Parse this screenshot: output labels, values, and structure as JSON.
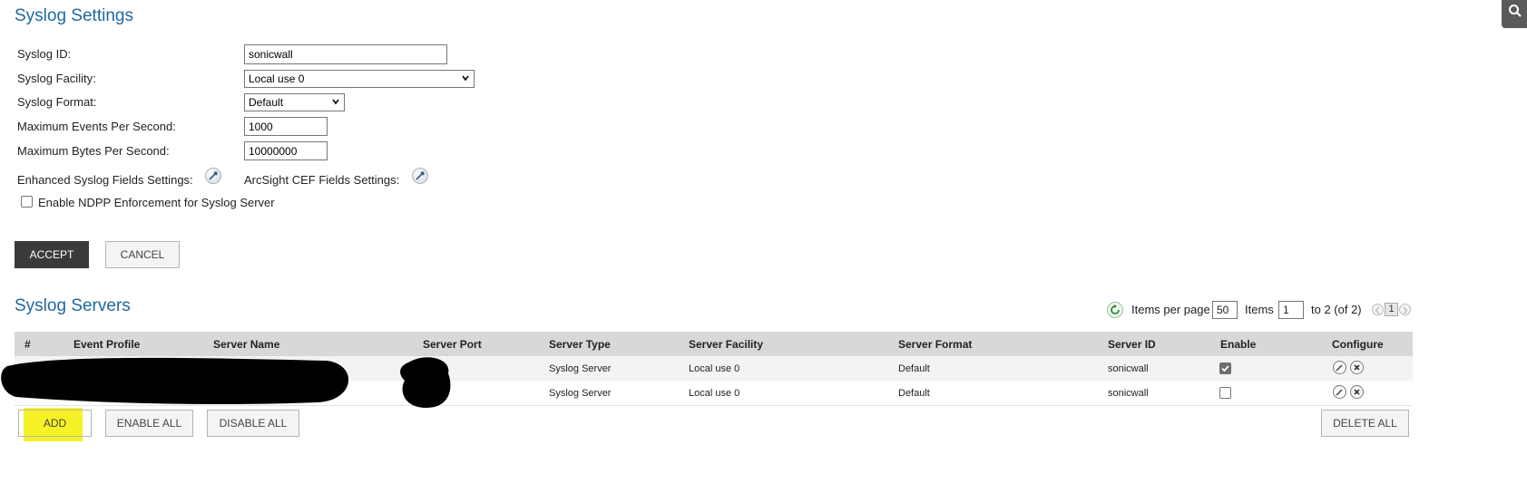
{
  "settings": {
    "title": "Syslog Settings",
    "syslog_id_label": "Syslog ID:",
    "syslog_id_value": "sonicwall",
    "facility_label": "Syslog Facility:",
    "facility_value": "Local use 0",
    "format_label": "Syslog Format:",
    "format_value": "Default",
    "max_events_label": "Maximum Events Per Second:",
    "max_events_value": "1000",
    "max_bytes_label": "Maximum Bytes Per Second:",
    "max_bytes_value": "10000000",
    "enhanced_label": "Enhanced Syslog Fields Settings:",
    "arcsight_label": "ArcSight CEF Fields Settings:",
    "ndpp_label": "Enable NDPP Enforcement for Syslog Server",
    "ndpp_checked": false,
    "accept_label": "ACCEPT",
    "cancel_label": "CANCEL"
  },
  "servers": {
    "title": "Syslog Servers",
    "items_per_page_label": "Items per page",
    "items_per_page_value": "50",
    "items_label": "Items",
    "items_start_value": "1",
    "items_range_text": "to 2 (of 2)",
    "current_page": "1",
    "columns": [
      "#",
      "Event Profile",
      "Server Name",
      "Server Port",
      "Server Type",
      "Server Facility",
      "Server Format",
      "Server ID",
      "Enable",
      "Configure"
    ],
    "rows": [
      {
        "type": "Syslog Server",
        "facility": "Local use 0",
        "format": "Default",
        "server_id": "sonicwall",
        "enabled": true
      },
      {
        "type": "Syslog Server",
        "facility": "Local use 0",
        "format": "Default",
        "server_id": "sonicwall",
        "enabled": false
      }
    ],
    "add_label": "ADD",
    "enable_all_label": "ENABLE ALL",
    "disable_all_label": "DISABLE ALL",
    "delete_all_label": "DELETE ALL"
  },
  "colors": {
    "title_blue": "#1e6aa0",
    "highlight": "#f6f226",
    "header_gray": "#d8d8d8"
  },
  "icons": [
    "search-icon",
    "tool-icon",
    "refresh-icon",
    "edit-icon",
    "delete-icon",
    "pager-prev-icon",
    "pager-next-icon"
  ]
}
